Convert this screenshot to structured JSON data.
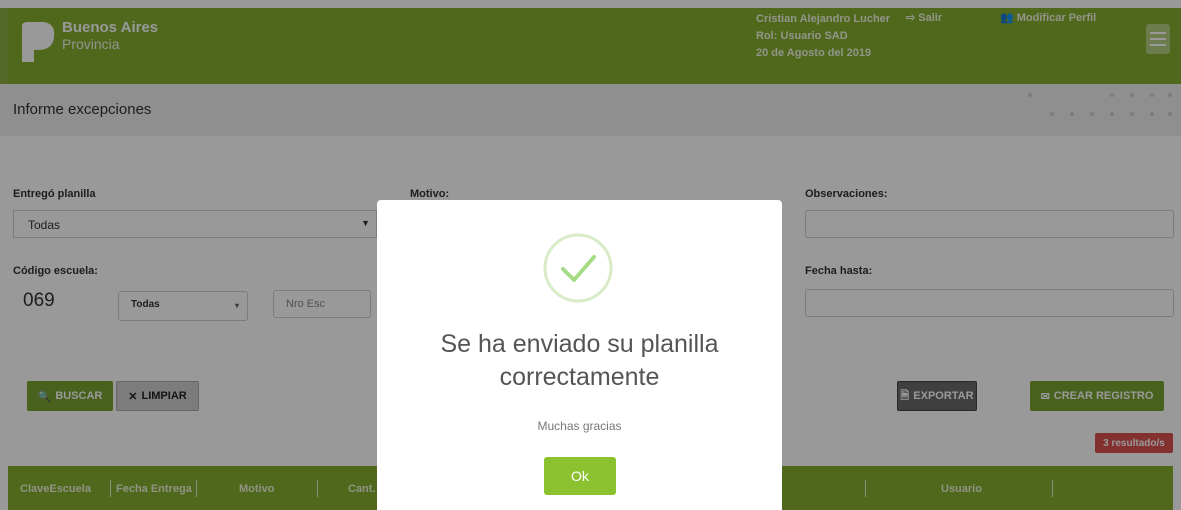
{
  "header": {
    "brand_line1": "Buenos Aires",
    "brand_line2": "Provincia",
    "user_name": "Cristian Alejandro Lucher",
    "user_role": "Rol: Usuario SAD",
    "date": "20 de Agosto del 2019",
    "logout_label": "Salir",
    "profile_label": "Modificar Perfil"
  },
  "page": {
    "title": "Informe excepciones"
  },
  "filters": {
    "entrego_label": "Entregó planilla",
    "entrego_value": "Todas",
    "motivo_label": "Motivo:",
    "observaciones_label": "Observaciones:",
    "observaciones_value": "",
    "codigo_label": "Código escuela:",
    "codigo_prefix": "069",
    "codigo_select_value": "Todas",
    "nro_esc_placeholder": "Nro Esc",
    "fecha_hasta_label": "Fecha hasta:",
    "fecha_hasta_value": ""
  },
  "actions": {
    "buscar": "BUSCAR",
    "limpiar": "LIMPIAR",
    "exportar": "EXPORTAR",
    "crear": "CREAR REGISTRO"
  },
  "results_badge": "3 resultado/s",
  "table": {
    "columns": [
      "ClaveEscuela",
      "Fecha Entrega",
      "Motivo",
      "Cant.",
      "Usuario"
    ]
  },
  "modal": {
    "title": "Se ha enviado su planilla correctamente",
    "subtitle": "Muchas gracias",
    "ok": "Ok"
  },
  "colors": {
    "brand_green": "#86ad2e",
    "check_green": "#a5dc86",
    "ok_green": "#8cc12f",
    "badge_red": "#d9534f"
  }
}
